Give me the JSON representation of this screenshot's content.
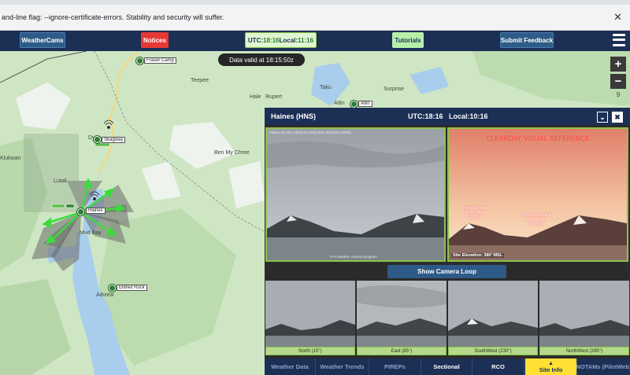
{
  "browser": {
    "infobar_message": "and-line flag: --ignore-certificate-errors. Stability and security will suffer.",
    "close_glyph": "✕"
  },
  "nav": {
    "weathercams": "WeatherCams",
    "notices": "Notices",
    "utc_label": "UTC:",
    "utc_time": "18:16",
    "local_label": " Local:",
    "local_time": "11:16",
    "tutorials": "Tutorials",
    "feedback": "Submit Feedback"
  },
  "map": {
    "valid_text": "Data valid at 18:15:50z",
    "zoom_in": "+",
    "zoom_out": "−",
    "zoom_level": "9",
    "places": [
      "Teepee",
      "Hale",
      "Rupert",
      "Taku",
      "Surprise",
      "Atlin",
      "Fraser Camp",
      "Skagway",
      "Ben My Chree",
      "Dyea",
      "Lutak",
      "Klukwan",
      "Haines",
      "Mud Bay",
      "Eldred Rock",
      "Adview"
    ],
    "stations": {
      "fraser": "Fraser Camp",
      "skagway": "Skagway",
      "haines": "Haines",
      "eldred": "Eldred Rock",
      "atlin": "Atlin"
    }
  },
  "panel": {
    "site_title": "Haines (HNS)",
    "utc": "UTC:18:16",
    "local": "Local:10:16",
    "collapse_glyph": "⌄",
    "close_glyph": "✖",
    "cam_timestamp": "haines (0)   Mon 09/16/24 (002)   Mon 09/16/24 (0000)",
    "cam_caption": "FAA weather camera program",
    "ref_title": "CLEARDAY VISUAL REFERENCE",
    "ref_pin1": "Haluta Ridge\n4590' MSL\n10.0 SM",
    "ref_pin2": "Mount Carmack\n5808' MSL\n24.0 SM",
    "ref_elevation": "Site Elevation: 380' MSL",
    "loop_button": "Show Camera Loop",
    "thumbs": [
      {
        "caption": "North (15°)"
      },
      {
        "caption": "East (85°)"
      },
      {
        "caption": "SouthWest (230°)"
      },
      {
        "caption": "NorthWest (295°)"
      }
    ],
    "tabs": [
      "Weather Data",
      "Weather Trends",
      "PIREPs",
      "Sectional",
      "RCO",
      "Site Info",
      "NOTAMs (PilotWeb)"
    ]
  },
  "colors": {
    "nav_bg": "#1c2f55",
    "notices_red": "#e53935",
    "tutorials_green": "#b6f0a8",
    "time_box": "#dff7d0",
    "panel_border_green": "#8bc34a",
    "site_info_yellow": "#ffe033",
    "map_land": "#cfe6c4",
    "map_water": "#a9cdec"
  }
}
